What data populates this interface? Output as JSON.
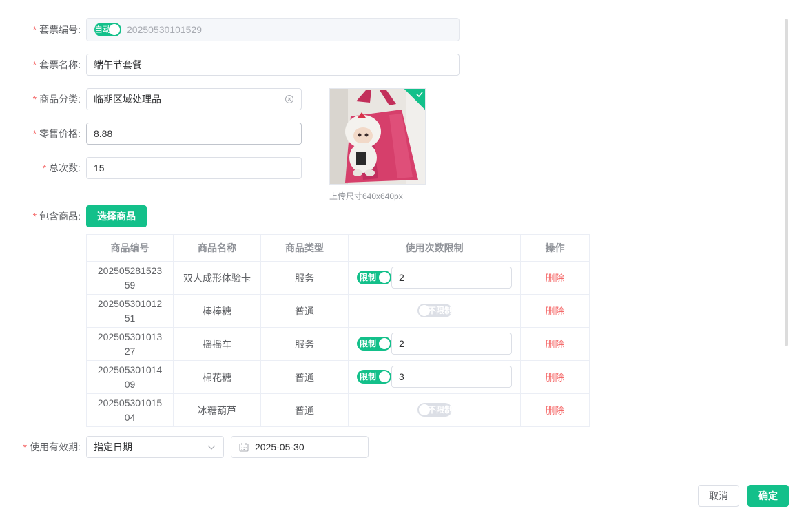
{
  "form": {
    "code_label": "套票编号:",
    "code_switch": "自动",
    "code_value": "20250530101529",
    "name_label": "套票名称:",
    "name_value": "端午节套餐",
    "category_label": "商品分类:",
    "category_value": "临期区域处理品",
    "price_label": "零售价格:",
    "price_value": "8.88",
    "count_label": "总次数:",
    "count_value": "15",
    "upload_hint": "上传尺寸640x640px",
    "goods_label": "包含商品:",
    "select_goods_button": "选择商品",
    "validity_label": "使用有效期:",
    "validity_type": "指定日期",
    "validity_date": "2025-05-30"
  },
  "table": {
    "headers": [
      "商品编号",
      "商品名称",
      "商品类型",
      "使用次数限制",
      "操作"
    ],
    "rows": [
      {
        "code": "20250528152359",
        "name": "双人成形体验卡",
        "type": "服务",
        "limited": true,
        "limit_label": "限制",
        "limit_value": "2",
        "action": "删除"
      },
      {
        "code": "20250530101251",
        "name": "棒棒糖",
        "type": "普通",
        "limited": false,
        "limit_label": "不限制",
        "limit_value": "",
        "action": "删除"
      },
      {
        "code": "20250530101327",
        "name": "摇摇车",
        "type": "服务",
        "limited": true,
        "limit_label": "限制",
        "limit_value": "2",
        "action": "删除"
      },
      {
        "code": "20250530101409",
        "name": "棉花糖",
        "type": "普通",
        "limited": true,
        "limit_label": "限制",
        "limit_value": "3",
        "action": "删除"
      },
      {
        "code": "20250530101504",
        "name": "冰糖葫芦",
        "type": "普通",
        "limited": false,
        "limit_label": "不限制",
        "limit_value": "",
        "action": "删除"
      }
    ]
  },
  "footer": {
    "cancel": "取消",
    "confirm": "确定"
  },
  "colors": {
    "primary": "#13c08a",
    "danger": "#f56c6c"
  },
  "icons": {
    "clear": "circle-close-icon",
    "select_arrow": "chevron-down-icon",
    "calendar": "calendar-icon",
    "uploaded": "check-icon"
  }
}
